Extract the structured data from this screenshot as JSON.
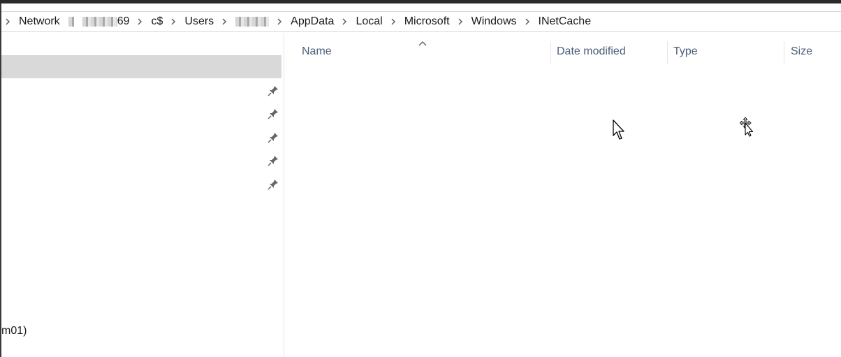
{
  "breadcrumb": {
    "items": [
      "Network",
      "69",
      "c$",
      "Users",
      "AppData",
      "Local",
      "Microsoft",
      "Windows",
      "INetCache"
    ]
  },
  "nav": {
    "bottom_text": "m01)"
  },
  "columns": {
    "name": "Name",
    "date_modified": "Date modified",
    "type": "Type",
    "size": "Size"
  },
  "icons": {
    "pin": "pin-icon",
    "chevron": "chevron-right-icon",
    "sort": "sort-ascending-icon",
    "arrow_cursor": "arrow-cursor-icon",
    "move_cursor": "move-cursor-icon"
  }
}
